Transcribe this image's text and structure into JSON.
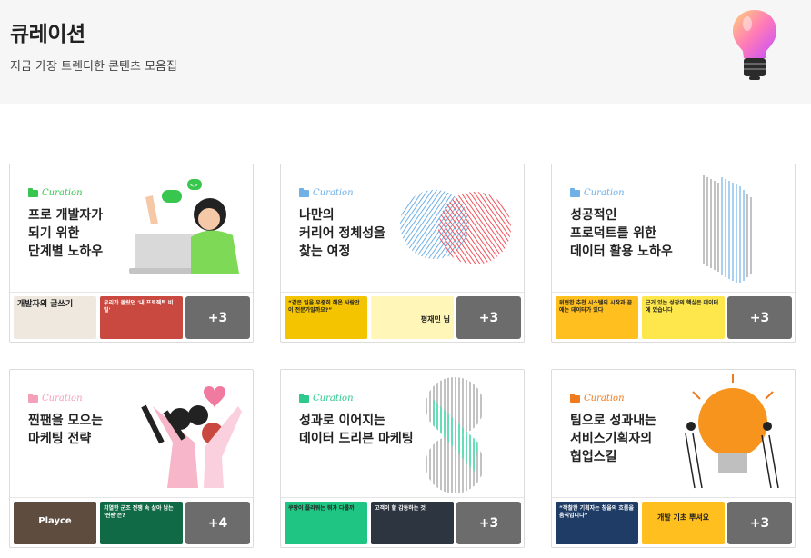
{
  "header": {
    "title": "큐레이션",
    "subtitle": "지금 가장 트렌디한 콘텐츠 모음집"
  },
  "cards": [
    {
      "tag": "Curation",
      "tag_color": "#39c64f",
      "title": "프로 개발자가\n되기 위한\n단계별 노하우",
      "thumbs": [
        "개발자의 글쓰기",
        "우리가 몰랐던 '내 프로젝트 비밀'"
      ],
      "more": "+3"
    },
    {
      "tag": "Curation",
      "tag_color": "#6fb0e6",
      "title": "나만의\n커리어 정체성을\n찾는 여정",
      "thumbs": [
        "“같은 일을 우중히 해온 사람만이 전문가일까요?”",
        "평재민 님"
      ],
      "more": "+3"
    },
    {
      "tag": "Curation",
      "tag_color": "#6fb0e6",
      "title": "성공적인\n프로덕트를 위한\n데이터 활용 노하우",
      "thumbs": [
        "위협한 추천 시스템의 시작과 끝에는 데이터가 있다",
        "근거 있는 성장의 핵심은 데이터에 있습니다"
      ],
      "more": "+3"
    },
    {
      "tag": "Curation",
      "tag_color": "#f3a0b9",
      "title": "찐팬을 모으는\n마케팅 전략",
      "thumbs": [
        "Playce",
        "치열한 군조 전쟁 속 살아 남는 '찐팬'은?"
      ],
      "more": "+4"
    },
    {
      "tag": "Curation",
      "tag_color": "#2ec98d",
      "title": "성과로 이어지는\n데이터 드리븐 마케팅",
      "thumbs": [
        "쿠팡이 플라워는 뭐가 다를까",
        "고객이 할 감동하는 것"
      ],
      "more": "+3"
    },
    {
      "tag": "Curation",
      "tag_color": "#f07a1e",
      "title": "팀으로 성과내는\n서비스기획자의\n협업스킬",
      "thumbs": [
        "“작찰한 기획자는 창을의 흐름을 움직입니다”",
        "개발 기초 뿌셔요"
      ],
      "more": "+3"
    }
  ]
}
